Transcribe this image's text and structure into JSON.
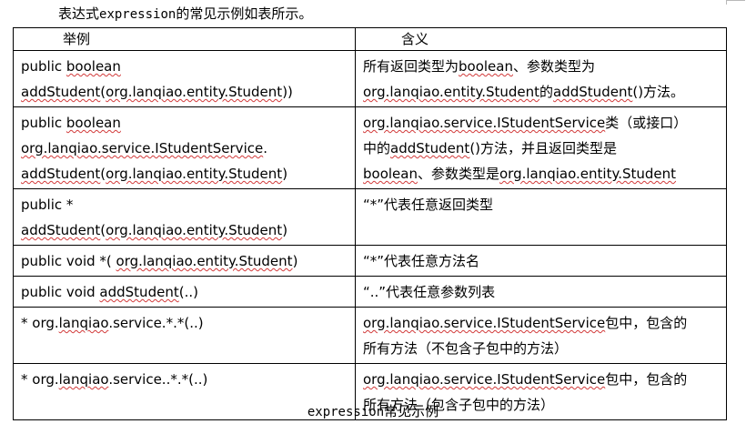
{
  "intro": {
    "prefix": "表达式",
    "code": "expression",
    "suffix": "的常见示例如表所示。"
  },
  "table": {
    "headers": [
      "举例",
      "含义"
    ],
    "rows": [
      {
        "example": [
          "public boolean",
          "addStudent(org.lanqiao.entity.Student))"
        ],
        "meaning": [
          "所有返回类型为boolean、参数类型为",
          "org.lanqiao.entity.Student的addStudent()方法。"
        ]
      },
      {
        "example": [
          "public boolean",
          "org.lanqiao.service.IStudentService.",
          "addStudent(org.lanqiao.entity.Student)"
        ],
        "meaning": [
          "org.lanqiao.service.IStudentService类（或接口）",
          "中的addStudent()方法，并且返回类型是",
          "boolean、参数类型是org.lanqiao.entity.Student"
        ]
      },
      {
        "example": [
          "public *",
          "addStudent(org.lanqiao.entity.Student)"
        ],
        "meaning": [
          "“*”代表任意返回类型"
        ]
      },
      {
        "example": [
          "public void *( org.lanqiao.entity.Student)"
        ],
        "meaning": [
          "“*”代表任意方法名"
        ]
      },
      {
        "example": [
          "public void addStudent(..)"
        ],
        "meaning": [
          "“..”代表任意参数列表"
        ]
      },
      {
        "example": [
          "* org.lanqiao.service.*.*(..)"
        ],
        "meaning": [
          "org.lanqiao.service.IStudentService包中，包含的",
          "所有方法（不包含子包中的方法）"
        ]
      },
      {
        "example": [
          "* org.lanqiao.service..*.*(..)"
        ],
        "meaning": [
          "org.lanqiao.service.IStudentService包中，包含的",
          "所有方法（包含子包中的方法）"
        ]
      }
    ]
  },
  "caption": {
    "code": "expression",
    "text": "常见示例"
  }
}
